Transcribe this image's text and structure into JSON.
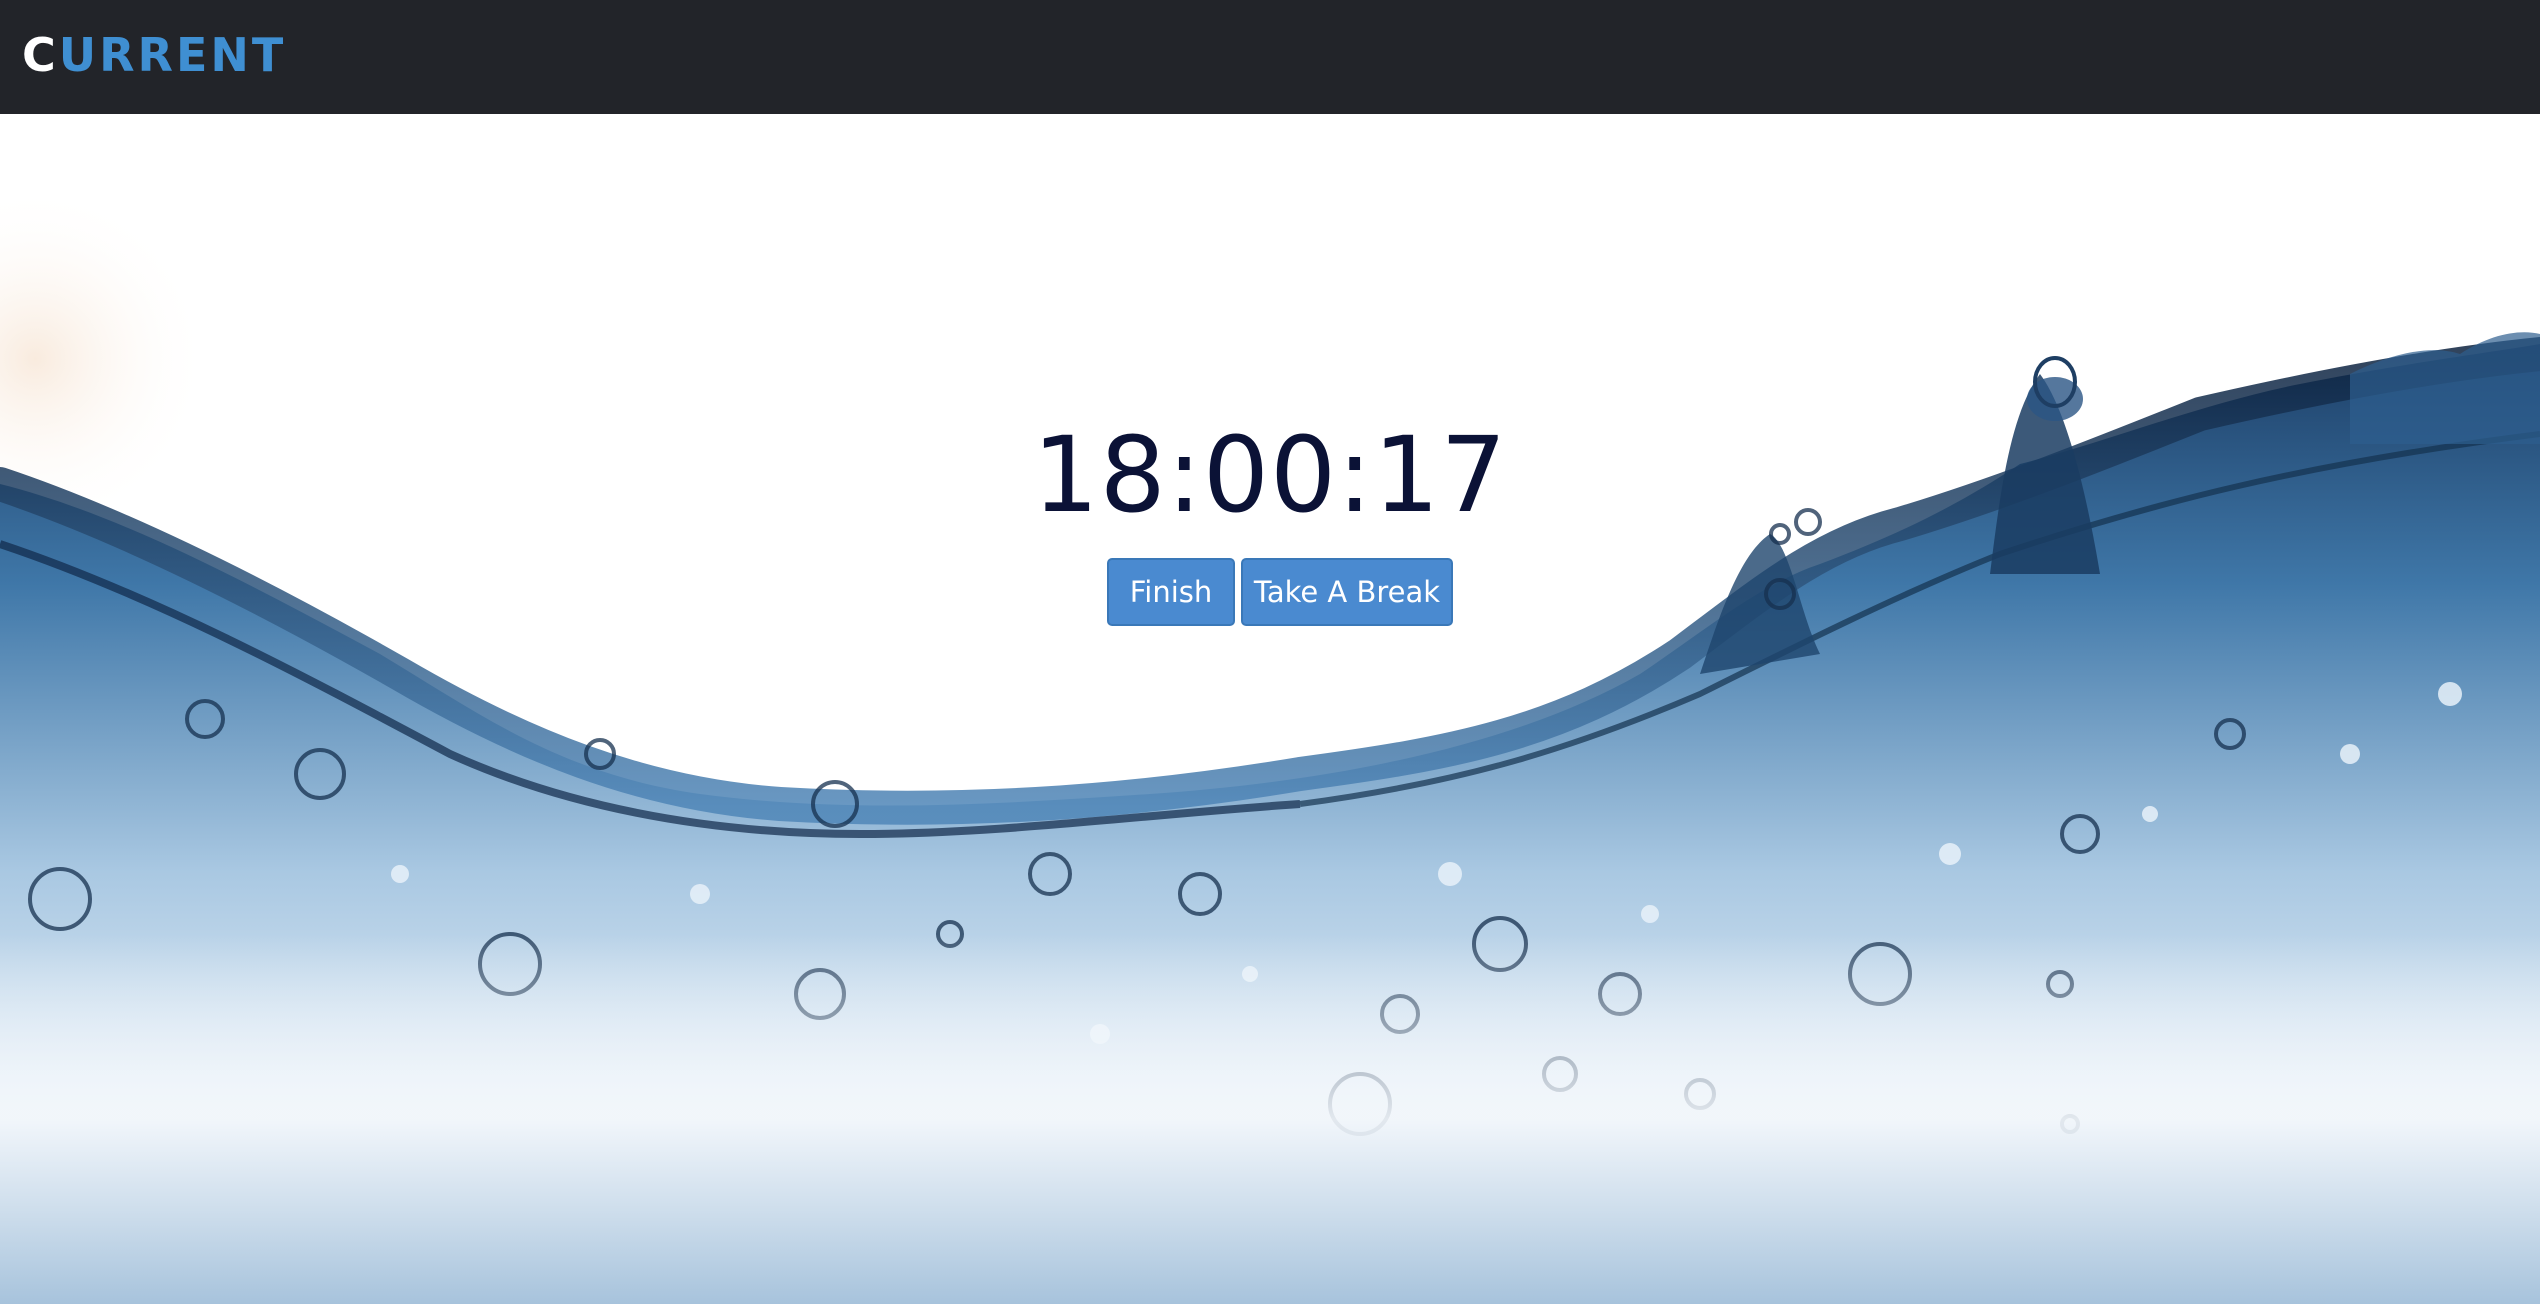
{
  "navbar": {
    "brand_first_letter": "C",
    "brand_rest": "URRENT"
  },
  "timer": {
    "display": "18:00:17"
  },
  "actions": {
    "finish_label": "Finish",
    "break_label": "Take A Break"
  },
  "colors": {
    "navbar_bg": "#222429",
    "brand_accent": "#3f8fd2",
    "button_bg": "#4a8ad0",
    "timer_text": "#0b1236"
  },
  "background": {
    "description_icon": "water-splash"
  }
}
